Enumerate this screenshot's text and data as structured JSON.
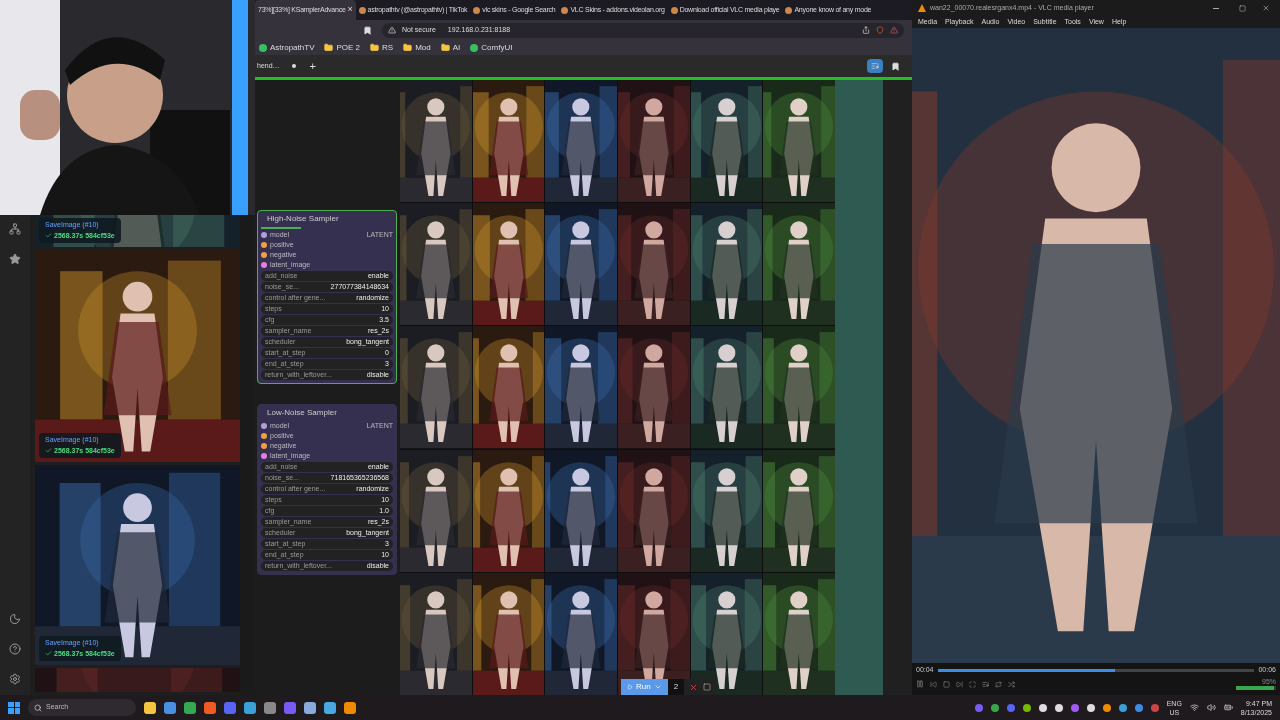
{
  "browser": {
    "tabs": [
      {
        "label": "73%][33%] KSamplerAdvance",
        "selected": true,
        "close": "×"
      },
      {
        "label": "astropathtv (@astropathtv) | TikTok",
        "selected": false
      },
      {
        "label": "vlc skins - Google Search",
        "selected": false
      },
      {
        "label": "VLC Skins - addons.videolan.org",
        "selected": false
      },
      {
        "label": "Download official VLC media playe",
        "selected": false
      },
      {
        "label": "Anyone know of any mode",
        "selected": false
      }
    ],
    "address": {
      "warning": "Not secure",
      "url": "192.168.0.231:8188"
    },
    "bookmarks": [
      {
        "label": "AstropathTV",
        "kind": "site"
      },
      {
        "label": "POE 2",
        "kind": "folder"
      },
      {
        "label": "RS",
        "kind": "folder"
      },
      {
        "label": "Mod",
        "kind": "folder"
      },
      {
        "label": "AI",
        "kind": "folder"
      },
      {
        "label": "ComfyUI",
        "kind": "site"
      }
    ],
    "workflow_tab": {
      "label": "hend…",
      "add": "+",
      "level": 1
    }
  },
  "comfy": {
    "gallery": [
      {
        "title": "SaveImage (#10)",
        "status": "2568.37s 584cf53e"
      },
      {
        "title": "SaveImage (#10)",
        "status": "2568.37s 584cf53e"
      },
      {
        "title": "SaveImage (#10)",
        "status": "2568.37s 584cf53e"
      }
    ],
    "nodes": [
      {
        "title": "High-Noise Sampler",
        "selected": true,
        "output": "LATENT",
        "inputs": [
          {
            "name": "model",
            "color": "#b39ddb"
          },
          {
            "name": "positive",
            "color": "#f0a040"
          },
          {
            "name": "negative",
            "color": "#f0a040"
          },
          {
            "name": "latent_image",
            "color": "#e080e0"
          }
        ],
        "widgets": [
          {
            "name": "add_noise",
            "value": "enable"
          },
          {
            "name": "noise_se...",
            "value": "277077384148634"
          },
          {
            "name": "control after gene...",
            "value": "randomize"
          },
          {
            "name": "steps",
            "value": "10"
          },
          {
            "name": "cfg",
            "value": "3.5"
          },
          {
            "name": "sampler_name",
            "value": "res_2s"
          },
          {
            "name": "scheduler",
            "value": "bong_tangent"
          },
          {
            "name": "start_at_step",
            "value": "0"
          },
          {
            "name": "end_at_step",
            "value": "3"
          },
          {
            "name": "return_with_leftover...",
            "value": "disable"
          }
        ]
      },
      {
        "title": "Low-Noise Sampler",
        "selected": false,
        "output": "LATENT",
        "inputs": [
          {
            "name": "model",
            "color": "#b39ddb"
          },
          {
            "name": "positive",
            "color": "#f0a040"
          },
          {
            "name": "negative",
            "color": "#f0a040"
          },
          {
            "name": "latent_image",
            "color": "#e080e0"
          }
        ],
        "widgets": [
          {
            "name": "add_noise",
            "value": "enable"
          },
          {
            "name": "noise_se...",
            "value": "718165365236568"
          },
          {
            "name": "control after gene...",
            "value": "randomize"
          },
          {
            "name": "steps",
            "value": "10"
          },
          {
            "name": "cfg",
            "value": "1.0"
          },
          {
            "name": "sampler_name",
            "value": "res_2s"
          },
          {
            "name": "scheduler",
            "value": "bong_tangent"
          },
          {
            "name": "start_at_step",
            "value": "3"
          },
          {
            "name": "end_at_step",
            "value": "10"
          },
          {
            "name": "return_with_leftover...",
            "value": "disable"
          }
        ]
      }
    ],
    "run_bar": {
      "label": "Run",
      "batch": "2"
    }
  },
  "vlc": {
    "title": "wan22_00070.realesrganx4.mp4 - VLC media player",
    "menus": [
      "Media",
      "Playback",
      "Audio",
      "Video",
      "Subtitle",
      "Tools",
      "View",
      "Help"
    ],
    "elapsed": "00:04",
    "total": "00:06",
    "level": 0.56,
    "volume": {
      "reading": "95%",
      "level": 0.95
    }
  },
  "taskbar": {
    "search": {
      "placeholder": "Search"
    },
    "language": "ENG",
    "region": "US",
    "time": "9:47 PM",
    "date": "8/13/2025"
  }
}
